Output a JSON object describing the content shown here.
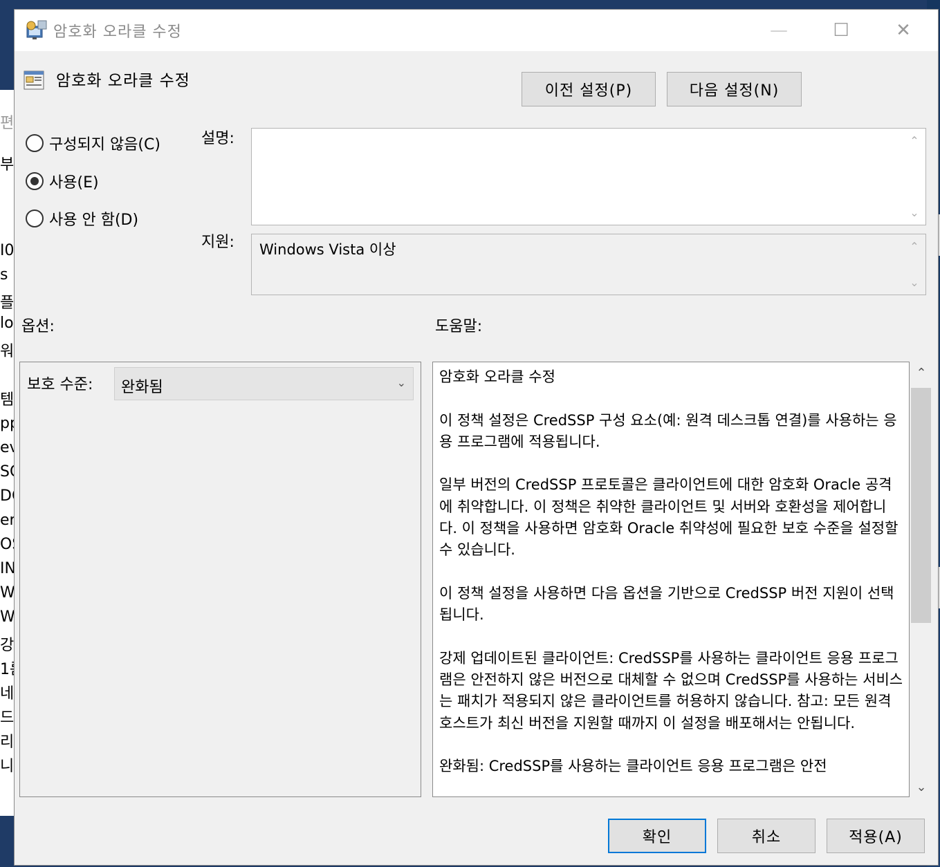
{
  "window": {
    "title": "암호화 오라클 수정",
    "controls": {
      "minimize": "—",
      "maximize": "☐",
      "close": "✕"
    }
  },
  "header": {
    "policy_title": "암호화 오라클 수정",
    "prev_button": "이전 설정(P)",
    "next_button": "다음 설정(N)"
  },
  "state": {
    "options": [
      {
        "label": "구성되지 않음(C)",
        "selected": false
      },
      {
        "label": "사용(E)",
        "selected": true
      },
      {
        "label": "사용 안 함(D)",
        "selected": false
      }
    ]
  },
  "labels": {
    "description": "설명:",
    "supported": "지원:",
    "options": "옵션:",
    "help": "도움말:"
  },
  "description_value": "",
  "supported_value": "Windows Vista 이상",
  "options_panel": {
    "protection_label": "보호 수준:",
    "protection_value": "완화됨"
  },
  "help_text": [
    "암호화 오라클 수정",
    "이 정책 설정은 CredSSP 구성 요소(예: 원격 데스크톱 연결)를 사용하는 응용 프로그램에 적용됩니다.",
    "일부 버전의 CredSSP 프로토콜은 클라이언트에 대한 암호화 Oracle 공격에 취약합니다. 이 정책은 취약한 클라이언트 및 서버와 호환성을 제어합니다. 이 정책을 사용하면 암호화 Oracle 취약성에 필요한 보호 수준을 설정할 수 있습니다.",
    "이 정책 설정을 사용하면 다음 옵션을 기반으로 CredSSP 버전 지원이 선택됩니다.",
    "강제 업데이트된 클라이언트: CredSSP를 사용하는 클라이언트 응용 프로그램은 안전하지 않은 버전으로 대체할 수 없으며 CredSSP를 사용하는 서비스는 패치가 적용되지 않은 클라이언트를 허용하지 않습니다. 참고: 모든 원격 호스트가 최신 버전을 지원할 때까지 이 설정을 배포해서는 안됩니다.",
    "완화됨: CredSSP를 사용하는 클라이언트 응용 프로그램은 안전"
  ],
  "footer": {
    "ok": "확인",
    "cancel": "취소",
    "apply": "적용(A)"
  },
  "colors": {
    "accent": "#0078d7",
    "dialog_bg": "#f0f0f0",
    "desktop": "#1f3b66"
  }
}
